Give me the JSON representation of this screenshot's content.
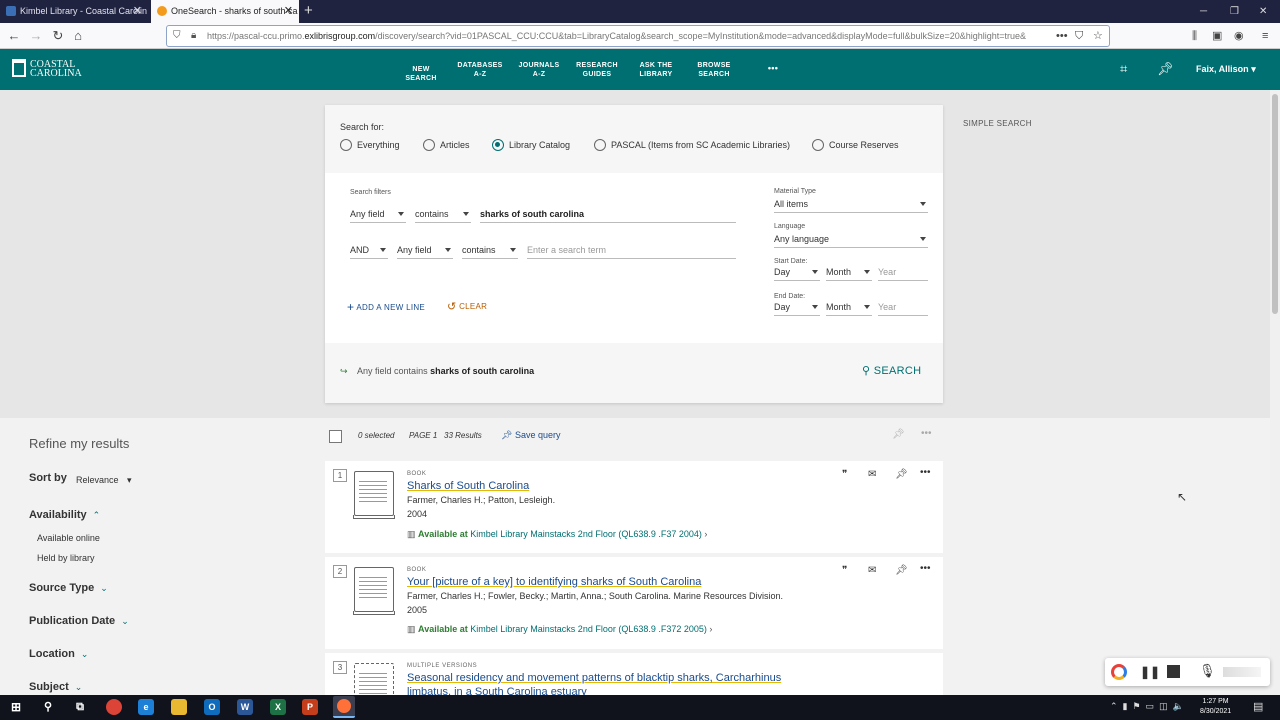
{
  "browser": {
    "tabs": [
      {
        "label": "Kimbel Library - Coastal Carolin",
        "close": "✕"
      },
      {
        "label": "OneSearch - sharks of south ca",
        "close": "✕"
      }
    ],
    "new_tab": "+",
    "url_prefix": "https://pascal-ccu.primo.",
    "url_domain": "exlibrisgroup.com",
    "url_rest": "/discovery/search?vid=01PASCAL_CCU:CCU&tab=LibraryCatalog&search_scope=MyInstitution&mode=advanced&displayMode=full&bulkSize=20&highlight=true&",
    "window_controls": [
      "─",
      "❐",
      "✕"
    ]
  },
  "header": {
    "logo_line1": "COASTAL",
    "logo_line2": "CAROLINA",
    "menu": [
      {
        "line1": "NEW SEARCH",
        "line2": ""
      },
      {
        "line1": "DATABASES",
        "line2": "A-Z"
      },
      {
        "line1": "JOURNALS",
        "line2": "A-Z"
      },
      {
        "line1": "RESEARCH",
        "line2": "GUIDES"
      },
      {
        "line1": "ASK THE",
        "line2": "LIBRARY"
      },
      {
        "line1": "BROWSE",
        "line2": "SEARCH"
      }
    ],
    "more": "•••",
    "user": "Faix, Allison"
  },
  "search": {
    "search_for_label": "Search for:",
    "scopes": [
      {
        "label": "Everything",
        "selected": false
      },
      {
        "label": "Articles",
        "selected": false
      },
      {
        "label": "Library Catalog",
        "selected": true
      },
      {
        "label": "PASCAL (Items from SC Academic Libraries)",
        "selected": false
      },
      {
        "label": "Course Reserves",
        "selected": false
      }
    ],
    "filters_label": "Search filters",
    "row1": {
      "field": "Any field",
      "op": "contains",
      "value": "sharks of south carolina"
    },
    "row2": {
      "bool": "AND",
      "field": "Any field",
      "op": "contains",
      "placeholder": "Enter a search term"
    },
    "material_type_label": "Material Type",
    "material_type_value": "All items",
    "language_label": "Language",
    "language_value": "Any language",
    "start_date_label": "Start Date:",
    "end_date_label": "End Date:",
    "day": "Day",
    "month": "Month",
    "year": "Year",
    "add_line": "ADD A NEW LINE",
    "clear": "CLEAR",
    "query_field": "Any field",
    "query_op": "contains",
    "query_value": "sharks of south carolina",
    "search_button": "SEARCH",
    "simple_search": "SIMPLE SEARCH"
  },
  "refine": {
    "title": "Refine my results",
    "sort_label": "Sort by",
    "sort_value": "Relevance",
    "facets": [
      "Availability",
      "Source Type",
      "Publication Date",
      "Location",
      "Subject"
    ],
    "availability_options": [
      "Available online",
      "Held by library"
    ]
  },
  "results_bar": {
    "selected": "0 selected",
    "page": "PAGE 1",
    "count": "33 Results",
    "save_query": "Save query"
  },
  "results": [
    {
      "num": "1",
      "type": "BOOK",
      "title": "Sharks of South Carolina",
      "authors": "Farmer, Charles H.; Patton, Lesleigh.",
      "year": "2004",
      "avail": "Available at",
      "library": "Kimbel Library",
      "location": "Mainstacks 2nd Floor (QL638.9 .F37 2004)"
    },
    {
      "num": "2",
      "type": "BOOK",
      "title": "Your [picture of a key] to identifying sharks of South Carolina",
      "authors": "Farmer, Charles H.; Fowler, Becky.; Martin, Anna.; South Carolina. Marine Resources Division.",
      "year": "2005",
      "avail": "Available at",
      "library": "Kimbel Library",
      "location": "Mainstacks 2nd Floor (QL638.9 .F372 2005)"
    },
    {
      "num": "3",
      "type": "MULTIPLE VERSIONS",
      "title": "Seasonal residency and movement patterns of blacktip sharks, Carcharhinus",
      "title2": "limbatus, in a South Carolina estuary"
    }
  ],
  "taskbar": {
    "time": "1:27 PM",
    "date": "8/30/2021"
  }
}
